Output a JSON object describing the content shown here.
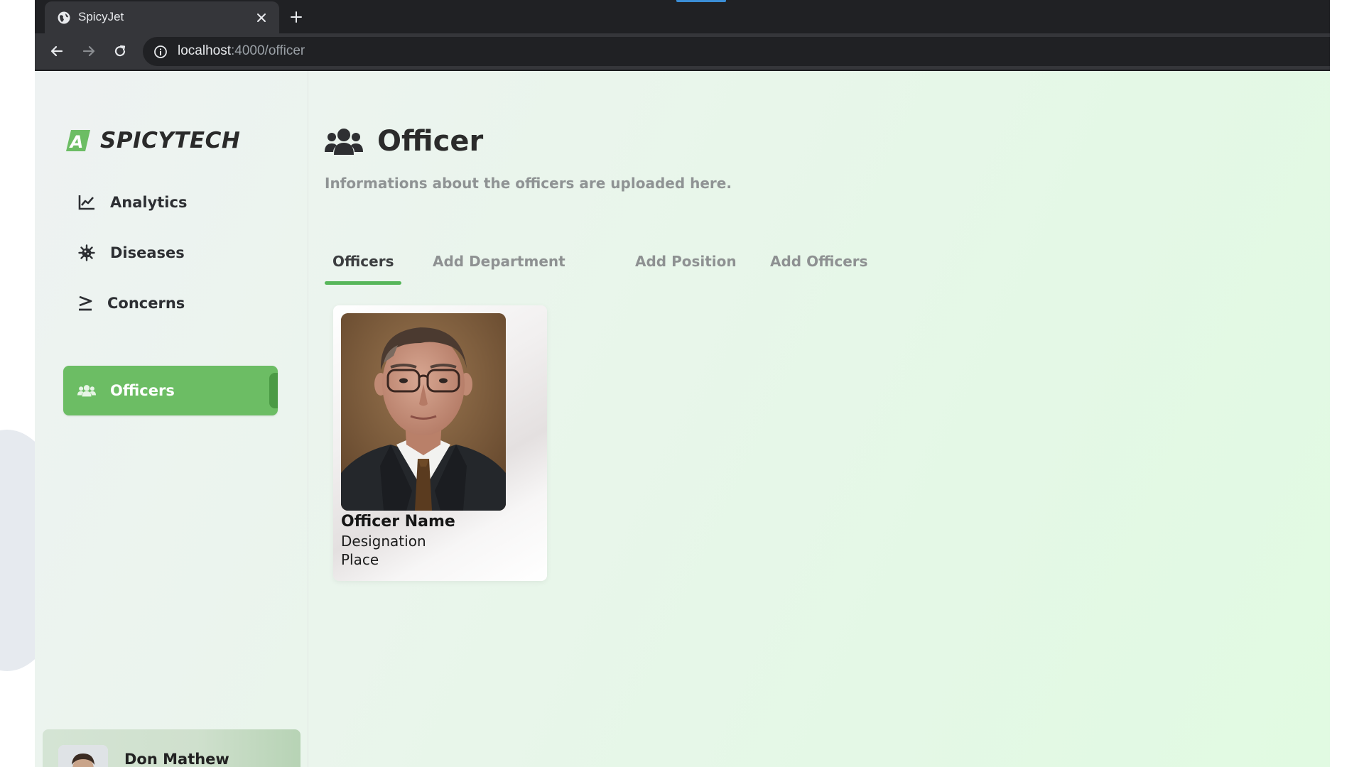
{
  "browser": {
    "tab_title": "SpicyJet",
    "url_host": "localhost",
    "url_rest": ":4000/officer",
    "icons": {
      "favicon": "globe-icon",
      "close": "close-icon",
      "new_tab": "plus-icon",
      "back": "arrow-left-icon",
      "forward": "arrow-right-icon",
      "reload": "reload-icon",
      "site_info": "info-icon"
    }
  },
  "brand": {
    "name": "SPICYTECH",
    "logo_letter": "A",
    "color": "#6cbd64"
  },
  "sidebar": {
    "items": [
      {
        "label": "Analytics",
        "icon": "line-chart-icon",
        "active": false
      },
      {
        "label": "Diseases",
        "icon": "virus-icon",
        "active": false
      },
      {
        "label": "Concerns",
        "icon": "greater-equal-icon",
        "active": false
      },
      {
        "label": "Officers",
        "icon": "users-icon",
        "active": true
      }
    ],
    "active_color": "#6cbd64"
  },
  "user": {
    "name": "Don Mathew",
    "icon": "avatar"
  },
  "page": {
    "title": "Officer",
    "icon": "users-icon",
    "subtitle": "Informations about the officers are uploaded here."
  },
  "tabs": [
    {
      "label": "Officers",
      "active": true
    },
    {
      "label": "Add Department",
      "active": false
    },
    {
      "label": "Add Position",
      "active": false
    },
    {
      "label": "Add Officers",
      "active": false
    }
  ],
  "officers": [
    {
      "name": "Officer Name",
      "designation": "Designation",
      "place": "Place",
      "photo": "officer-portrait"
    }
  ]
}
